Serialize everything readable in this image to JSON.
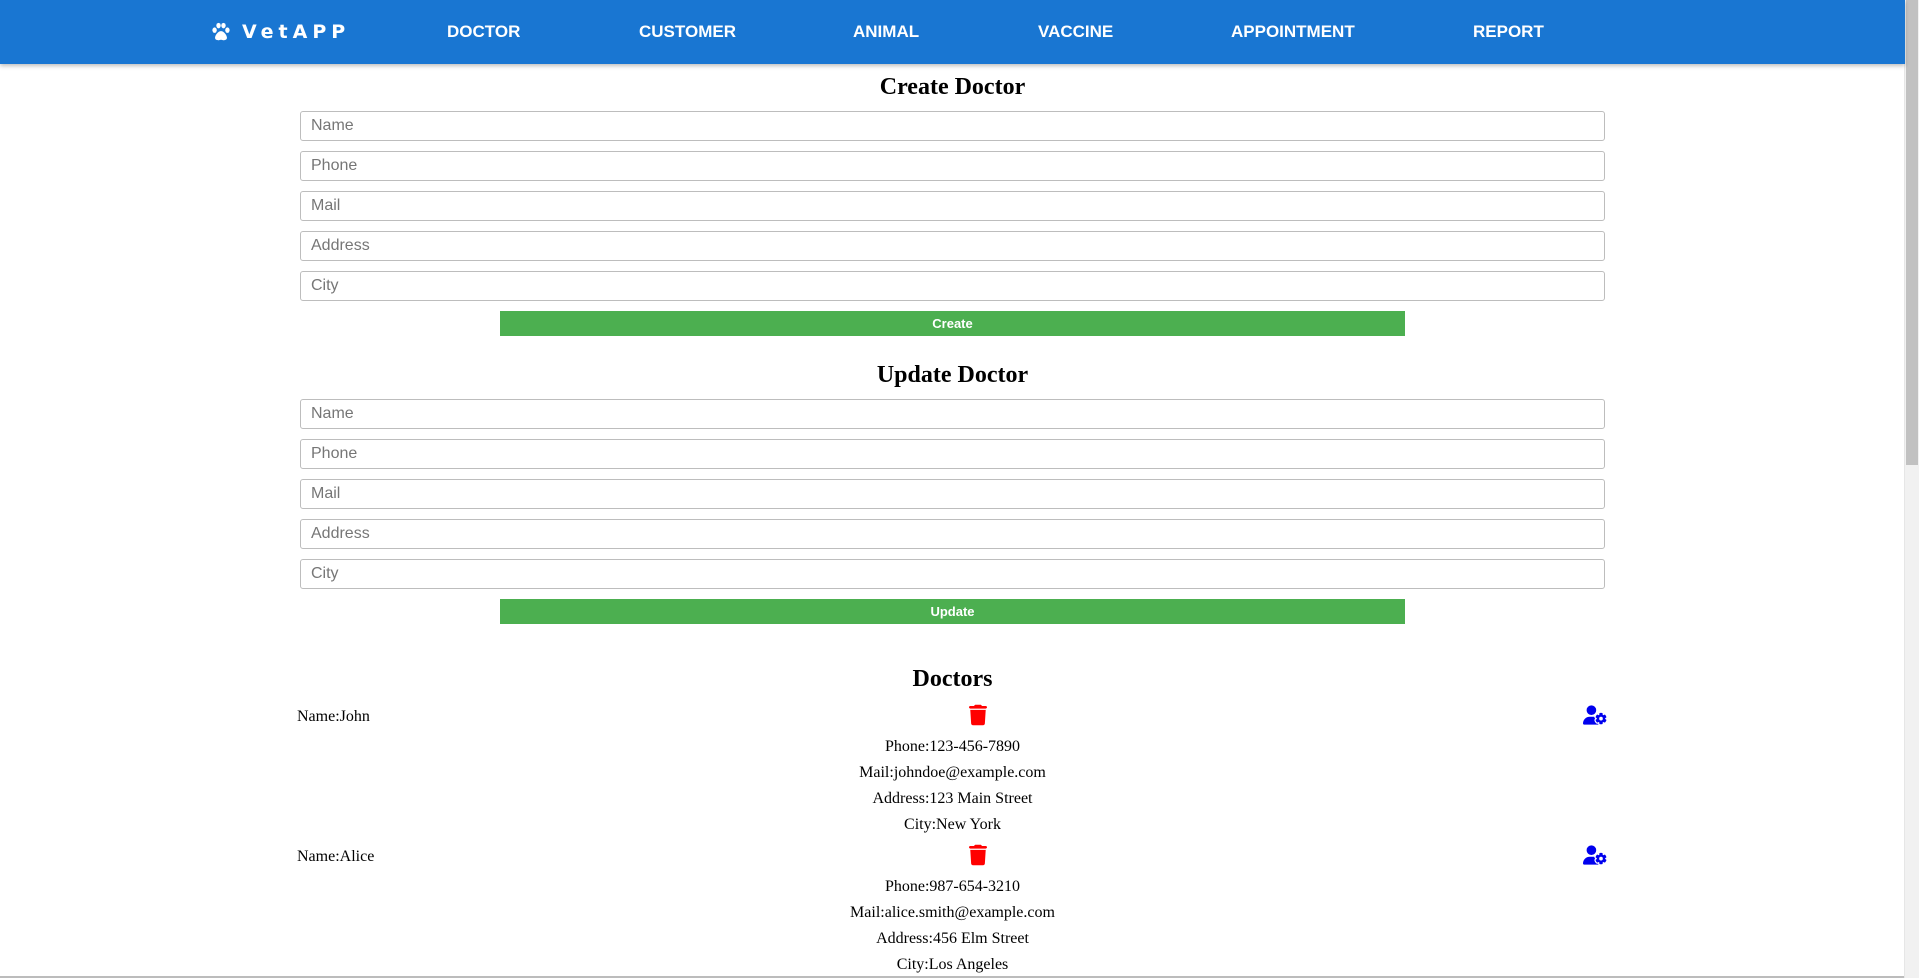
{
  "nav": {
    "brand": "VetAPP",
    "items": [
      {
        "label": "DOCTOR"
      },
      {
        "label": "CUSTOMER"
      },
      {
        "label": "ANIMAL"
      },
      {
        "label": "VACCINE"
      },
      {
        "label": "APPOINTMENT"
      },
      {
        "label": "REPORT"
      }
    ]
  },
  "create_form": {
    "title": "Create Doctor",
    "name_placeholder": "Name",
    "phone_placeholder": "Phone",
    "mail_placeholder": "Mail",
    "address_placeholder": "Address",
    "city_placeholder": "City",
    "button_label": "Create"
  },
  "update_form": {
    "title": "Update Doctor",
    "name_placeholder": "Name",
    "phone_placeholder": "Phone",
    "mail_placeholder": "Mail",
    "address_placeholder": "Address",
    "city_placeholder": "City",
    "button_label": "Update"
  },
  "doctors": {
    "title": "Doctors",
    "labels": {
      "name": "Name:",
      "phone": "Phone:",
      "mail": "Mail:",
      "address": "Address:",
      "city": "City:"
    },
    "items": [
      {
        "name": "John",
        "phone": "123-456-7890",
        "mail": "johndoe@example.com",
        "address": "123 Main Street",
        "city": "New York"
      },
      {
        "name": "Alice",
        "phone": "987-654-3210",
        "mail": "alice.smith@example.com",
        "address": "456 Elm Street",
        "city": "Los Angeles"
      }
    ]
  },
  "icons": {
    "brand_icon": "paw-icon",
    "delete_icon": "trash-icon",
    "edit_icon": "user-gear-icon"
  },
  "colors": {
    "navbar": "#1976d2",
    "button": "#4caf50",
    "delete_icon": "#ff0000",
    "edit_icon": "#0000ee"
  }
}
